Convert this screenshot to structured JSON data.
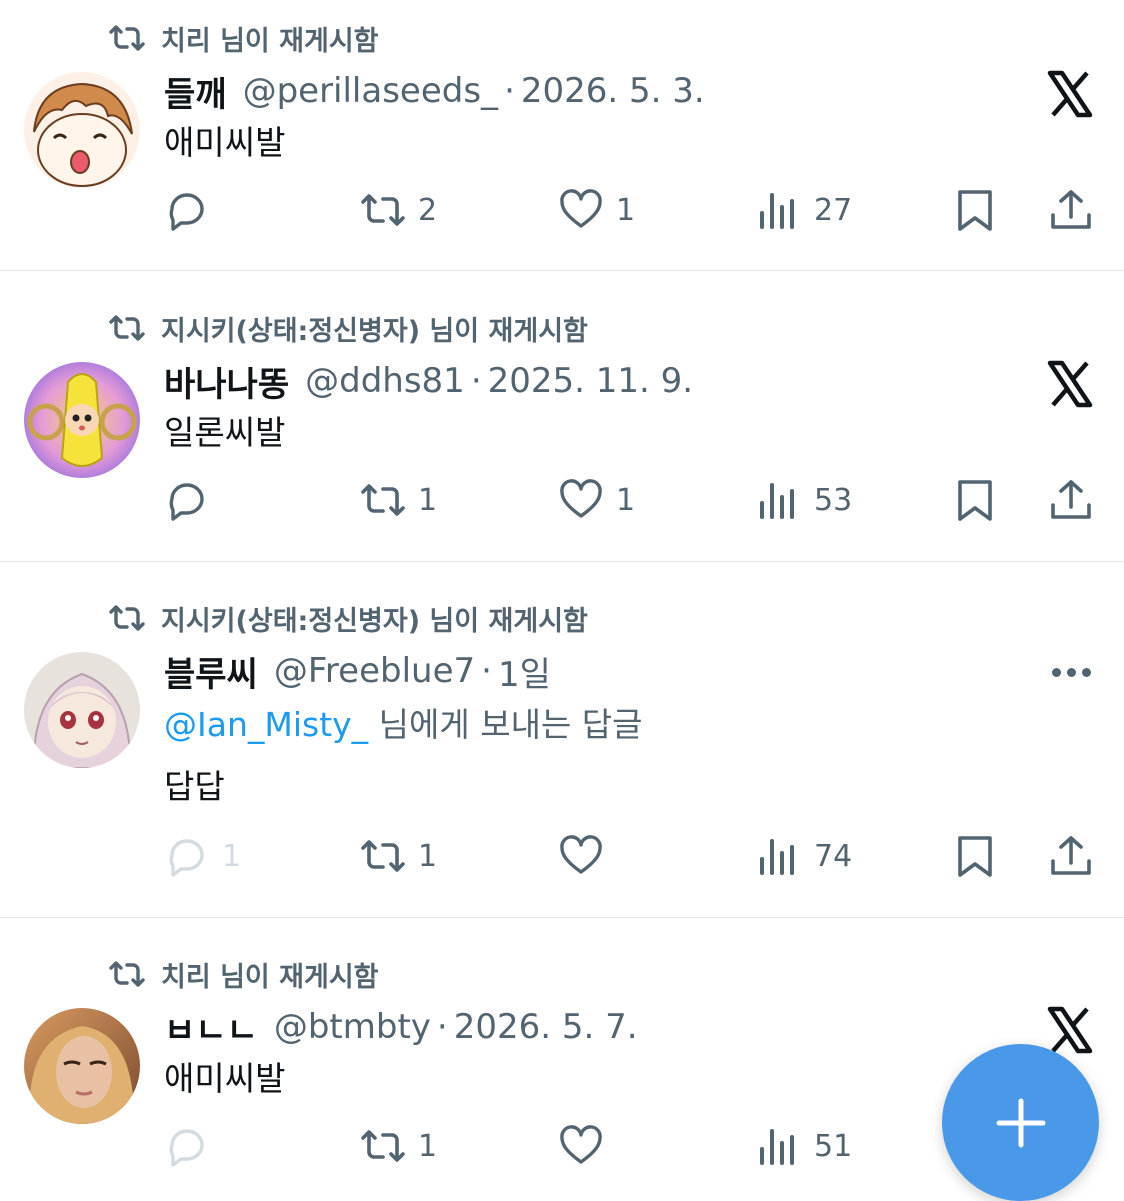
{
  "colors": {
    "accent": "#1d9bf0",
    "secondary_text": "#536471",
    "fab": "#4a99e9",
    "divider": "#e1e5e8"
  },
  "tweets": [
    {
      "retweeted_by": "치리 님이 재게시함",
      "name": "들깨",
      "handle": "@perillaseeds_",
      "separator": "·",
      "time": "2026. 5. 3.",
      "text": "애미씨발",
      "corner_icon": "x-logo-icon",
      "replies": "",
      "retweets": "2",
      "likes": "1",
      "views": "27"
    },
    {
      "retweeted_by": "지시키(상태:정신병자) 님이 재게시함",
      "name": "바나나똥",
      "handle": "@ddhs81",
      "separator": "·",
      "time": "2025. 11. 9.",
      "text": "일론씨발",
      "corner_icon": "x-logo-icon",
      "replies": "",
      "retweets": "1",
      "likes": "1",
      "views": "53"
    },
    {
      "retweeted_by": "지시키(상태:정신병자) 님이 재게시함",
      "name": "블루씨",
      "handle": "@Freeblue7",
      "separator": "·",
      "time": "1일",
      "reply_to_mention": "@Ian_Misty_",
      "reply_to_suffix": " 님에게 보내는 답글",
      "text": "답답",
      "corner_icon": "more-icon",
      "replies": "1",
      "retweets": "1",
      "likes": "",
      "views": "74"
    },
    {
      "retweeted_by": "치리 님이 재게시함",
      "name": "ㅂㄴㄴ",
      "handle": "@btmbty",
      "separator": "·",
      "time": "2026. 5. 7.",
      "text": "애미씨발",
      "corner_icon": "x-logo-icon",
      "replies": "",
      "retweets": "1",
      "likes": "",
      "views": "51"
    }
  ],
  "fab": {
    "icon": "plus-icon"
  }
}
